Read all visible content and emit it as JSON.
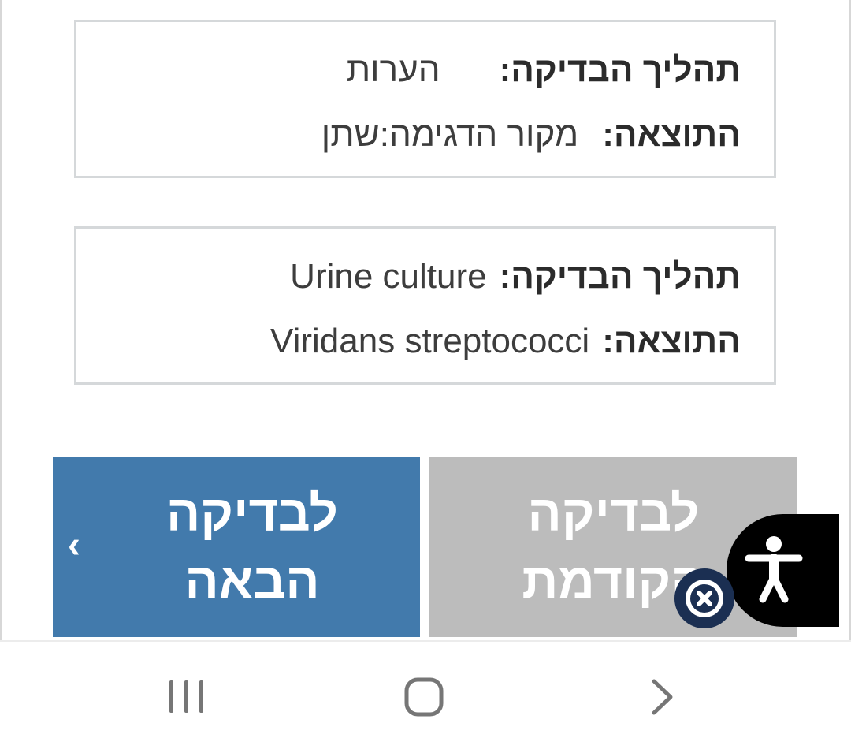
{
  "cards": [
    {
      "procedure_label": "תהליך הבדיקה:",
      "procedure_value": "הערות",
      "result_label": "התוצאה:",
      "result_value": "מקור הדגימה:שתן"
    },
    {
      "procedure_label": "תהליך הבדיקה:",
      "procedure_value": "Urine culture",
      "result_label": "התוצאה:",
      "result_value": "Viridans streptococci"
    }
  ],
  "buttons": {
    "next_label": "לבדיקה\nהבאה",
    "prev_label": "לבדיקה\nהקודמת",
    "next_chevron": "‹"
  },
  "colors": {
    "next_button": "#427aac",
    "prev_button": "#bcbcbc",
    "accessibility_widget": "#000000",
    "close_badge": "#1b2f52"
  },
  "icons": {
    "accessibility": "accessibility-person-icon",
    "close": "close-x-icon",
    "recents": "recent-apps-icon",
    "home": "home-icon",
    "back": "back-chevron-icon"
  }
}
